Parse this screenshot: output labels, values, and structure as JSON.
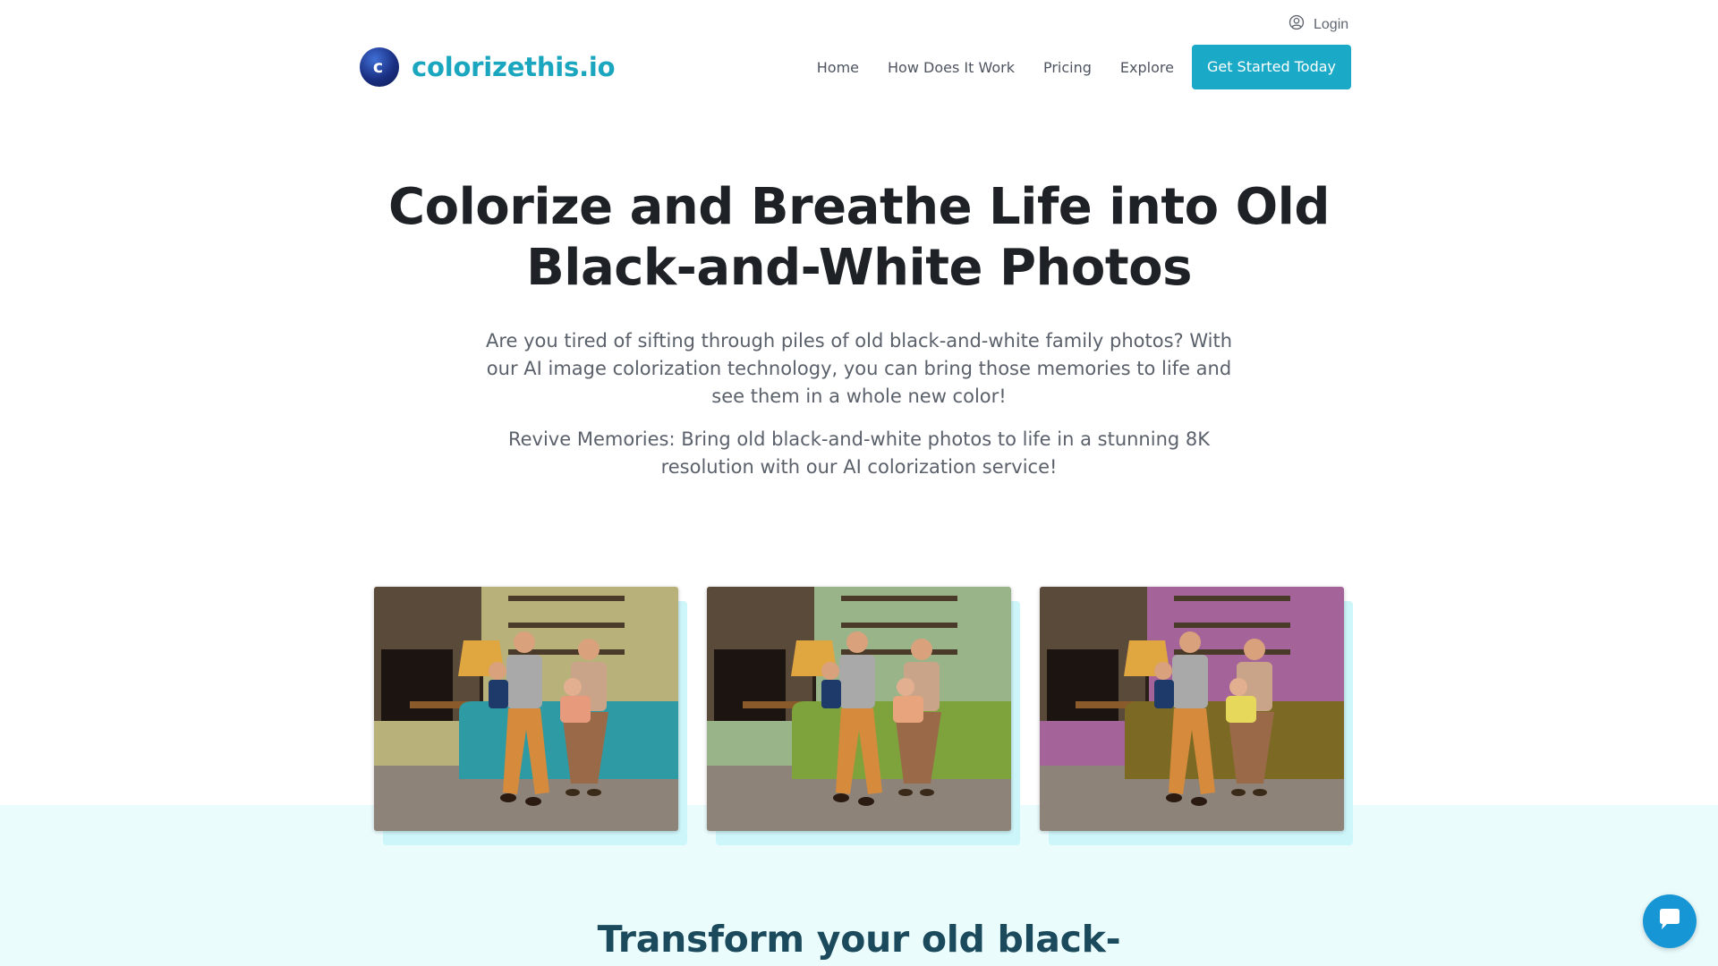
{
  "header": {
    "login_label": "Login",
    "logo_letter": "c",
    "logo_text": "colorizethis.io",
    "nav": [
      {
        "label": "Home"
      },
      {
        "label": "How Does It Work"
      },
      {
        "label": "Pricing"
      },
      {
        "label": "Explore"
      }
    ],
    "cta_label": "Get Started Today"
  },
  "hero": {
    "title_line1": "Colorize and Breathe Life into Old",
    "title_line2": "Black-and-White Photos",
    "paragraph1": "Are you tired of sifting through piles of old black-and-white family photos? With our AI image colorization technology, you can bring those memories to life and see them in a whole new color!",
    "paragraph2": "Revive Memories: Bring old black-and-white photos to life in a stunning 8K resolution with our AI colorization service!"
  },
  "gallery": {
    "photos": [
      {
        "sofa_color": "#2e9aa3",
        "wall_color": "#b8b27a",
        "child_color": "#e89a7c"
      },
      {
        "sofa_color": "#7ea33c",
        "wall_color": "#9ab48a",
        "child_color": "#e8a47c"
      },
      {
        "sofa_color": "#7c6a24",
        "wall_color": "#a4649a",
        "child_color": "#e6d85a"
      }
    ]
  },
  "section": {
    "title": "Transform your old black-"
  },
  "colors": {
    "accent": "#1aa9c7",
    "logo_text": "#1ba6bf",
    "band": "#ebfcfd",
    "chat": "#1796d6"
  },
  "icons": {
    "login": "user-circle-icon",
    "chat": "chat-bubble-icon"
  }
}
